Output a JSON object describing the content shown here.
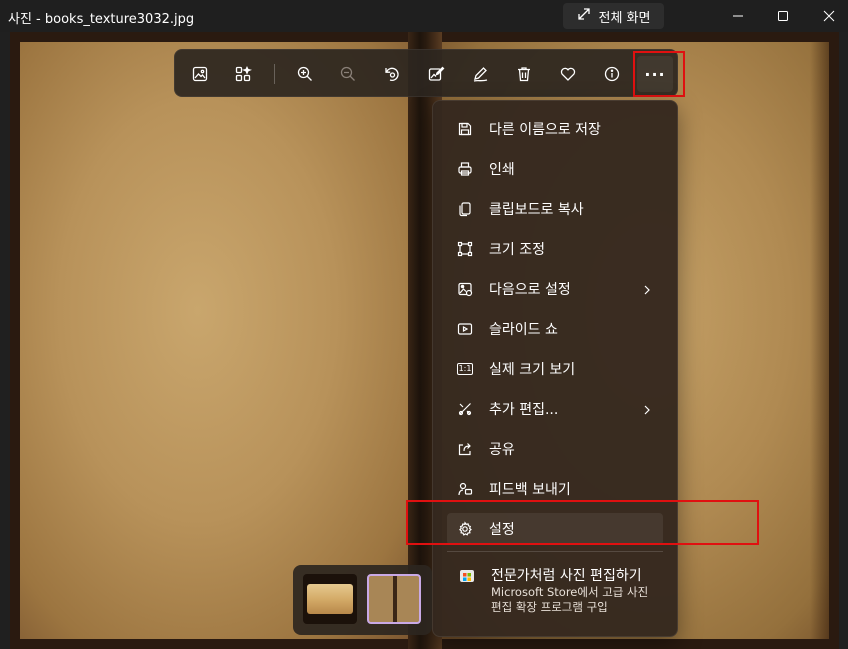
{
  "window": {
    "title": "사진 - books_texture3032.jpg",
    "fullscreen_label": "전체 화면"
  },
  "toolbar": {
    "buttons": [
      {
        "name": "view-icon"
      },
      {
        "name": "gallery-icon"
      },
      {
        "name": "zoom-in-icon"
      },
      {
        "name": "zoom-out-icon"
      },
      {
        "name": "rotate-icon"
      },
      {
        "name": "edit-image-icon"
      },
      {
        "name": "draw-icon"
      },
      {
        "name": "delete-icon"
      },
      {
        "name": "favorite-icon"
      },
      {
        "name": "info-icon"
      },
      {
        "name": "more-icon"
      }
    ],
    "more_glyph": "···"
  },
  "menu": {
    "items": [
      {
        "label": "다른 이름으로 저장",
        "icon": "save-icon"
      },
      {
        "label": "인쇄",
        "icon": "print-icon"
      },
      {
        "label": "클립보드로 복사",
        "icon": "copy-icon"
      },
      {
        "label": "크기 조정",
        "icon": "resize-icon"
      },
      {
        "label": "다음으로 설정",
        "icon": "set-as-icon",
        "submenu": true
      },
      {
        "label": "슬라이드 쇼",
        "icon": "slideshow-icon"
      },
      {
        "label": "실제 크기 보기",
        "icon": "actual-size-icon"
      },
      {
        "label": "추가 편집...",
        "icon": "more-edit-icon",
        "submenu": true
      },
      {
        "label": "공유",
        "icon": "share-icon"
      },
      {
        "label": "피드백 보내기",
        "icon": "feedback-icon"
      },
      {
        "label": "설정",
        "icon": "gear-icon",
        "selected": true
      }
    ],
    "promo": {
      "title": "전문가처럼 사진 편집하기",
      "description": "Microsoft Store에서 고급 사진 편집 확장 프로그램 구입"
    },
    "actual_size_glyph": "1:1"
  },
  "colors": {
    "highlight": "#e01010",
    "selected_thumb_border": "#c9a9e6"
  }
}
